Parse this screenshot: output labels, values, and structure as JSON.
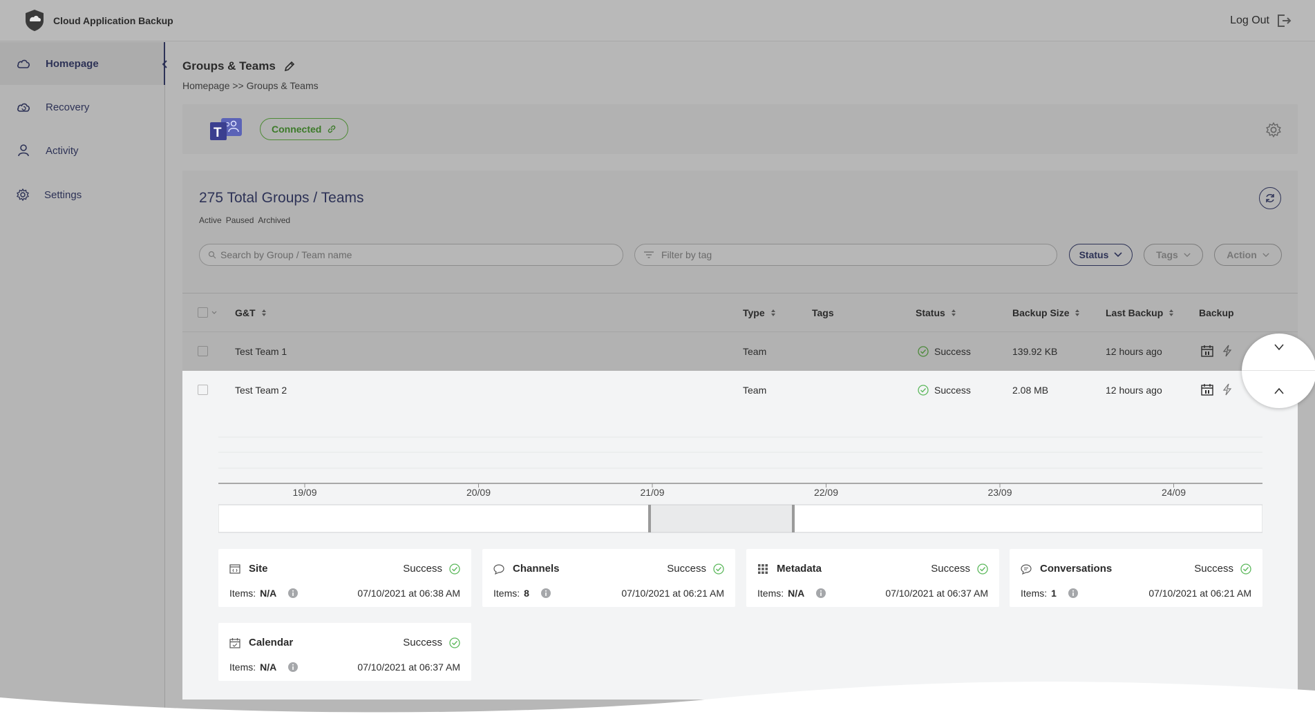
{
  "app": {
    "title": "Cloud Application Backup",
    "logout_label": "Log Out"
  },
  "sidebar": {
    "items": [
      {
        "label": "Homepage",
        "icon": "cloud-icon",
        "active": true
      },
      {
        "label": "Recovery",
        "icon": "cloud-recovery-icon",
        "active": false
      },
      {
        "label": "Activity",
        "icon": "user-icon",
        "active": false
      },
      {
        "label": "Settings",
        "icon": "gear-icon",
        "active": false
      }
    ]
  },
  "page": {
    "title": "Groups & Teams",
    "breadcrumb": "Homepage >> Groups & Teams"
  },
  "connection": {
    "status_label": "Connected",
    "status_color": "#3c7a29"
  },
  "list": {
    "total_title": "275 Total Groups / Teams",
    "quick_filters": [
      "Active",
      "Paused",
      "Archived"
    ],
    "search_placeholder": "Search by Group / Team name",
    "tag_placeholder": "Filter by tag",
    "buttons": {
      "status": "Status",
      "tags": "Tags",
      "action": "Action"
    },
    "columns": [
      "G&T",
      "Type",
      "Tags",
      "Status",
      "Backup Size",
      "Last Backup",
      "Backup"
    ],
    "rows": [
      {
        "name": "Test Team 1",
        "type": "Team",
        "tags": "",
        "status": "Success",
        "size": "139.92 KB",
        "last_backup": "12 hours ago"
      },
      {
        "name": "Test Team 2",
        "type": "Team",
        "tags": "",
        "status": "Success",
        "size": "2.08 MB",
        "last_backup": "12 hours ago"
      }
    ]
  },
  "timeline": {
    "ticks": [
      "19/09",
      "20/09",
      "21/09",
      "22/09",
      "23/09",
      "24/09"
    ]
  },
  "details": [
    {
      "title": "Site",
      "icon": "site-icon",
      "status": "Success",
      "items_label": "Items:",
      "items_value": "N/A",
      "date": "07/10/2021 at 06:38 AM"
    },
    {
      "title": "Channels",
      "icon": "chat-bubble-icon",
      "status": "Success",
      "items_label": "Items:",
      "items_value": "8",
      "date": "07/10/2021 at 06:21 AM"
    },
    {
      "title": "Metadata",
      "icon": "grid-icon",
      "status": "Success",
      "items_label": "Items:",
      "items_value": "N/A",
      "date": "07/10/2021 at 06:37 AM"
    },
    {
      "title": "Conversations",
      "icon": "conversation-icon",
      "status": "Success",
      "items_label": "Items:",
      "items_value": "1",
      "date": "07/10/2021 at 06:21 AM"
    },
    {
      "title": "Calendar",
      "icon": "calendar-icon",
      "status": "Success",
      "items_label": "Items:",
      "items_value": "N/A",
      "date": "07/10/2021 at 06:37 AM"
    }
  ],
  "colors": {
    "accent": "#2d3256",
    "success": "#5cb85c",
    "panel": "#f3f4f5"
  }
}
